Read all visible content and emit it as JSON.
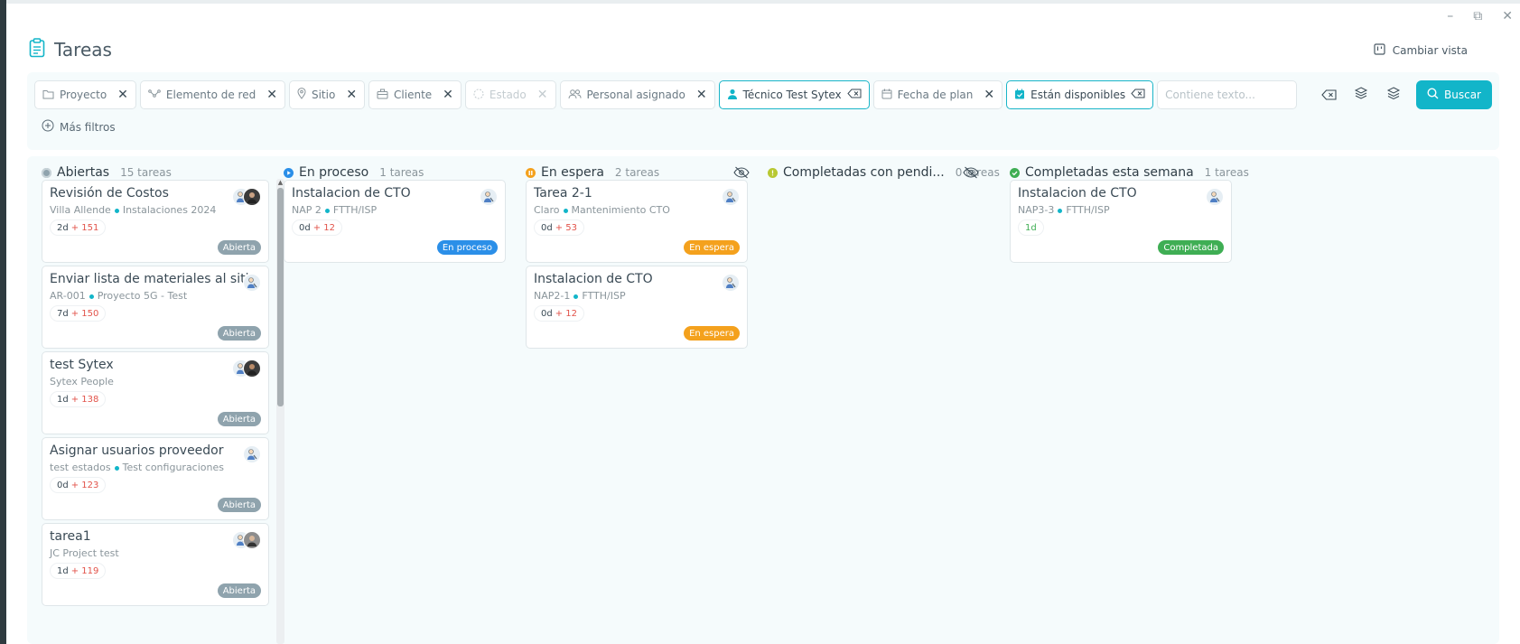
{
  "app": {
    "title": "Tareas",
    "change_view_label": "Cambiar vista"
  },
  "window_controls": {
    "minimize": "–",
    "restore": "⧉",
    "close": "✕"
  },
  "filters": {
    "chips": [
      {
        "label": "Proyecto",
        "icon": "folder-icon",
        "state": "normal"
      },
      {
        "label": "Elemento de red",
        "icon": "network-icon",
        "state": "normal"
      },
      {
        "label": "Sitio",
        "icon": "location-pin-icon",
        "state": "normal"
      },
      {
        "label": "Cliente",
        "icon": "briefcase-icon",
        "state": "normal"
      },
      {
        "label": "Estado",
        "icon": "circle-icon",
        "state": "disabled"
      },
      {
        "label": "Personal asignado",
        "icon": "users-icon",
        "state": "normal"
      },
      {
        "label": "Técnico Test Sytex",
        "icon": "user-icon",
        "state": "active"
      },
      {
        "label": "Fecha de plan",
        "icon": "calendar-icon",
        "state": "normal"
      },
      {
        "label": "Están disponibles",
        "icon": "calendar-check-icon",
        "state": "active"
      }
    ],
    "text_placeholder": "Contiene texto...",
    "more_filters_label": "Más filtros",
    "search_label": "Buscar"
  },
  "colors": {
    "accent": "#12b5c9",
    "abierta": "#8fa3ad",
    "en_proceso": "#2b8fe8",
    "en_espera": "#f4a11d",
    "pendientes": "#b8c832",
    "completada": "#3fae54"
  },
  "columns": [
    {
      "title": "Abiertas",
      "count": "15 tareas",
      "status_color": "#8fa3ad",
      "cards": [
        {
          "title": "Revisión de Costos",
          "sub_a": "Villa Allende",
          "sub_b": "Instalaciones 2024",
          "age": "2d",
          "late": "+ 151",
          "badge": "Abierta",
          "avatars": 2
        },
        {
          "title": "Enviar lista de materiales al sitio",
          "sub_a": "AR-001",
          "sub_b": "Proyecto 5G - Test",
          "age": "7d",
          "late": "+ 150",
          "badge": "Abierta",
          "avatars": 1
        },
        {
          "title": "test Sytex",
          "sub_a": "Sytex People",
          "sub_b": "",
          "age": "1d",
          "late": "+ 138",
          "badge": "Abierta",
          "avatars": 2
        },
        {
          "title": "Asignar usuarios proveedor",
          "sub_a": "test estados",
          "sub_b": "Test configuraciones",
          "age": "0d",
          "late": "+ 123",
          "badge": "Abierta",
          "avatars": 1
        },
        {
          "title": "tarea1",
          "sub_a": "JC Project test",
          "sub_b": "",
          "age": "1d",
          "late": "+ 119",
          "badge": "Abierta",
          "avatars": 2
        }
      ]
    },
    {
      "title": "En proceso",
      "count": "1 tareas",
      "status_color": "#2b8fe8",
      "cards": [
        {
          "title": "Instalacion de CTO",
          "sub_a": "NAP 2",
          "sub_b": "FTTH/ISP",
          "age": "0d",
          "late": "+ 12",
          "badge": "En proceso",
          "avatars": 1
        }
      ]
    },
    {
      "title": "En espera",
      "count": "2 tareas",
      "status_color": "#f4a11d",
      "hidden_toggle": true,
      "cards": [
        {
          "title": "Tarea 2-1",
          "sub_a": "Claro",
          "sub_b": "Mantenimiento CTO",
          "age": "0d",
          "late": "+ 53",
          "badge": "En espera",
          "avatars": 1
        },
        {
          "title": "Instalacion de CTO",
          "sub_a": "NAP2-1",
          "sub_b": "FTTH/ISP",
          "age": "0d",
          "late": "+ 12",
          "badge": "En espera",
          "avatars": 1
        }
      ]
    },
    {
      "title": "Completadas con pendi...",
      "count": "0 tareas",
      "status_color": "#b8c832",
      "hidden_toggle": true,
      "cards": []
    },
    {
      "title": "Completadas esta semana",
      "count": "1 tareas",
      "status_color": "#3fae54",
      "cards": [
        {
          "title": "Instalacion de CTO",
          "sub_a": "NAP3-3",
          "sub_b": "FTTH/ISP",
          "age": "1d",
          "late": "",
          "badge": "Completada",
          "avatars": 1
        }
      ]
    }
  ]
}
